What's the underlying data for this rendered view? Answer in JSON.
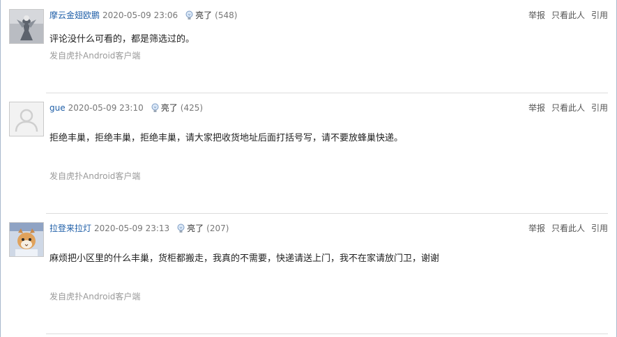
{
  "posts": [
    {
      "username": "摩云金翅欧鹏",
      "time": "2020-05-09 23:06",
      "light_label": "亮了",
      "light_count": "(548)",
      "content": "评论没什么可看的，都是筛选过的。",
      "source": "发自虎扑Android客户端",
      "actions": {
        "report": "举报",
        "only_him": "只看此人",
        "quote": "引用"
      }
    },
    {
      "username": "gue",
      "time": "2020-05-09 23:10",
      "light_label": "亮了",
      "light_count": "(425)",
      "content": "拒绝丰巢，拒绝丰巢，拒绝丰巢，请大家把收货地址后面打括号写，请不要放蜂巢快递。",
      "source": "发自虎扑Android客户端",
      "actions": {
        "report": "举报",
        "only_him": "只看此人",
        "quote": "引用"
      }
    },
    {
      "username": "拉登来拉灯",
      "time": "2020-05-09 23:13",
      "light_label": "亮了",
      "light_count": "(207)",
      "content": "麻烦把小区里的什么丰巢，货柜都搬走，我真的不需要，快递请送上门，我不在家请放门卫，谢谢",
      "source": "发自虎扑Android客户端",
      "actions": {
        "report": "举报",
        "only_him": "只看此人",
        "quote": "引用"
      }
    }
  ],
  "colors": {
    "username": "#1f5fa8",
    "divider": "#dcdcdc",
    "muted": "#9a9a9a"
  }
}
